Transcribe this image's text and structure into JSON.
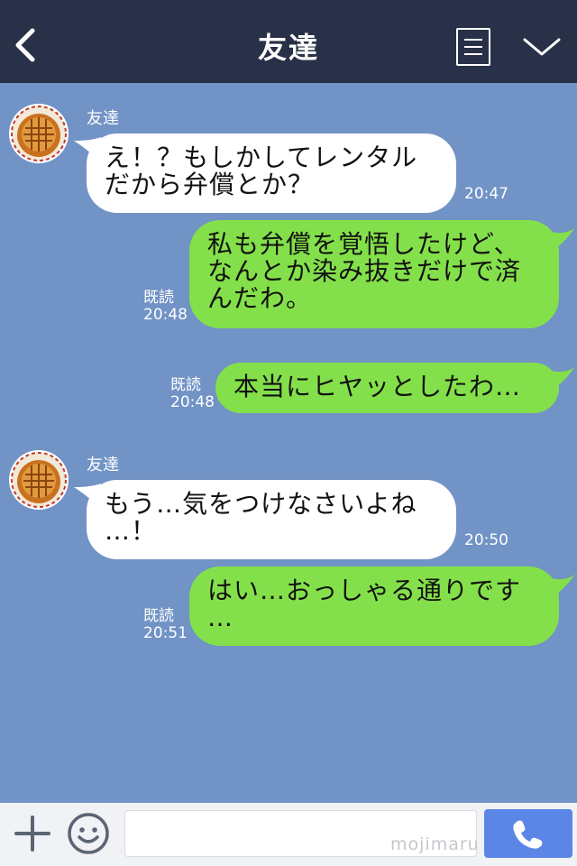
{
  "header": {
    "title": "友達",
    "back_icon": "chevron-left-icon",
    "menu_icon": "notes-icon",
    "collapse_icon": "chevron-down-icon"
  },
  "messages": [
    {
      "side": "left",
      "sender": "友達",
      "lines": [
        "え！？もしかしてレンタル",
        "だから弁償とか？"
      ],
      "time": "20:47"
    },
    {
      "side": "right",
      "read_label": "既読",
      "lines": [
        "私も弁償を覚悟したけど、",
        "なんとか染み抜きだけで済",
        "んだわ。"
      ],
      "time": "20:48"
    },
    {
      "side": "right",
      "read_label": "既読",
      "lines": [
        "本当にヒヤッとしたわ…"
      ],
      "time": "20:48"
    },
    {
      "side": "left",
      "sender": "友達",
      "lines": [
        "もう…気をつけなさいよね",
        "…！"
      ],
      "time": "20:50"
    },
    {
      "side": "right",
      "read_label": "既読",
      "lines": [
        "はい…おっしゃる通りです",
        "…"
      ],
      "time": "20:51"
    }
  ],
  "footer": {
    "input_value": "",
    "watermark": "mojimaru",
    "plus_icon": "plus-icon",
    "emoji_icon": "smiley-icon",
    "call_icon": "phone-icon"
  },
  "colors": {
    "header_bg": "#283147",
    "chat_bg": "#7193c5",
    "incoming_bubble": "#ffffff",
    "outgoing_bubble": "#84e04a",
    "call_button": "#5b86e6"
  }
}
